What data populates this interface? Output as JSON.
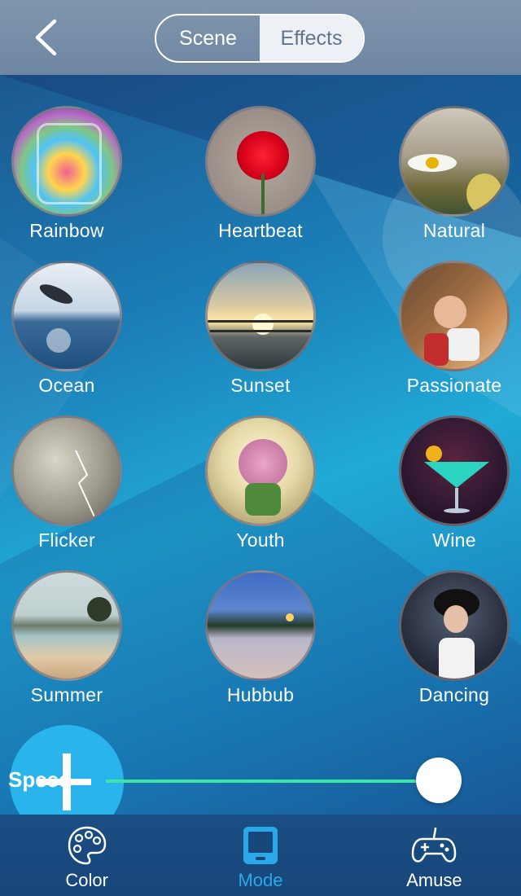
{
  "header": {
    "segments": [
      {
        "label": "Scene",
        "active": false
      },
      {
        "label": "Effects",
        "active": true
      }
    ]
  },
  "effects": [
    {
      "label": "Rainbow",
      "icon": "candy-jar-photo"
    },
    {
      "label": "Heartbeat",
      "icon": "red-carnation-photo"
    },
    {
      "label": "Natural",
      "icon": "daisy-photo"
    },
    {
      "label": "Ocean",
      "icon": "dolphin-photo"
    },
    {
      "label": "Sunset",
      "icon": "sunset-pier-photo"
    },
    {
      "label": "Passionate",
      "icon": "couple-embrace-photo"
    },
    {
      "label": "Flicker",
      "icon": "lightning-storm-photo"
    },
    {
      "label": "Youth",
      "icon": "hyacinth-flower-photo"
    },
    {
      "label": "Wine",
      "icon": "cocktail-glass-photo"
    },
    {
      "label": "Summer",
      "icon": "beach-shore-photo"
    },
    {
      "label": "Hubbub",
      "icon": "city-square-photo"
    },
    {
      "label": "Dancing",
      "icon": "singer-photo"
    }
  ],
  "speed": {
    "label": "Speed",
    "value": 0.95
  },
  "tabbar": {
    "items": [
      {
        "label": "Color",
        "icon": "palette-icon"
      },
      {
        "label": "Mode",
        "icon": "tablet-mode-icon"
      },
      {
        "label": "Amuse",
        "icon": "gamepad-icon"
      }
    ],
    "selected": "Mode"
  },
  "colors": {
    "accent": "#2aa9e8",
    "slider_track": "#3ee6a6"
  }
}
